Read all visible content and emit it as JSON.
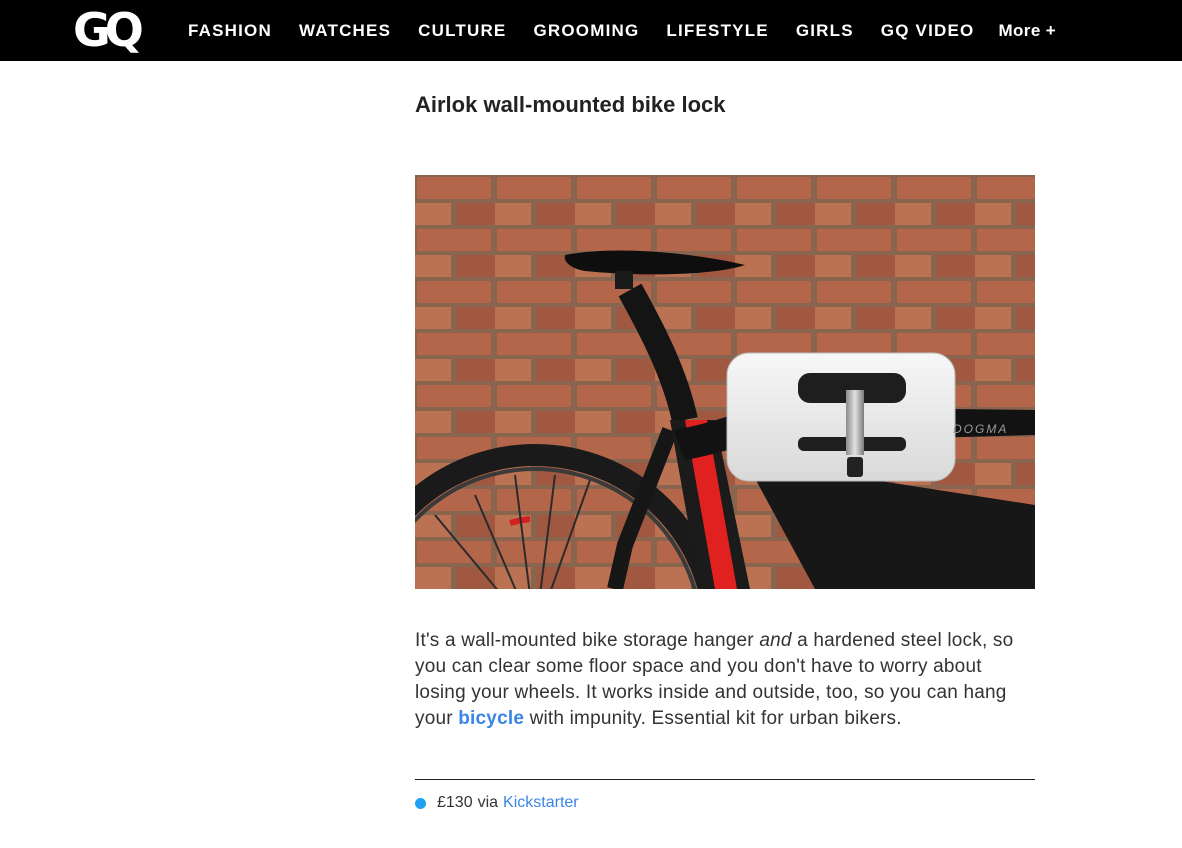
{
  "header": {
    "logo": "GQ",
    "nav": [
      "FASHION",
      "WATCHES",
      "CULTURE",
      "GROOMING",
      "LIFESTYLE",
      "GIRLS",
      "GQ VIDEO"
    ],
    "more": "More +"
  },
  "article": {
    "title": "Airlok wall-mounted bike lock",
    "image_alt": "Road bike hung on a white Airlok wall mount against a brick wall",
    "body": {
      "p1": "It's a wall-mounted bike storage hanger ",
      "em": "and",
      "p2": " a hardened steel lock, so you can clear some floor space and you don't have to worry about losing your wheels. It works inside and outside, too, so you can hang your ",
      "link": "bicycle",
      "p3": " with impunity. Essential kit for urban bikers."
    },
    "price": {
      "amount": "£130",
      "via": "via",
      "retailer": "Kickstarter",
      "dot_color": "#1da1f2"
    }
  },
  "colors": {
    "header_bg": "#000000",
    "link": "#3a86e8",
    "brick": "#b86a4c",
    "frame_red": "#e0211f"
  }
}
